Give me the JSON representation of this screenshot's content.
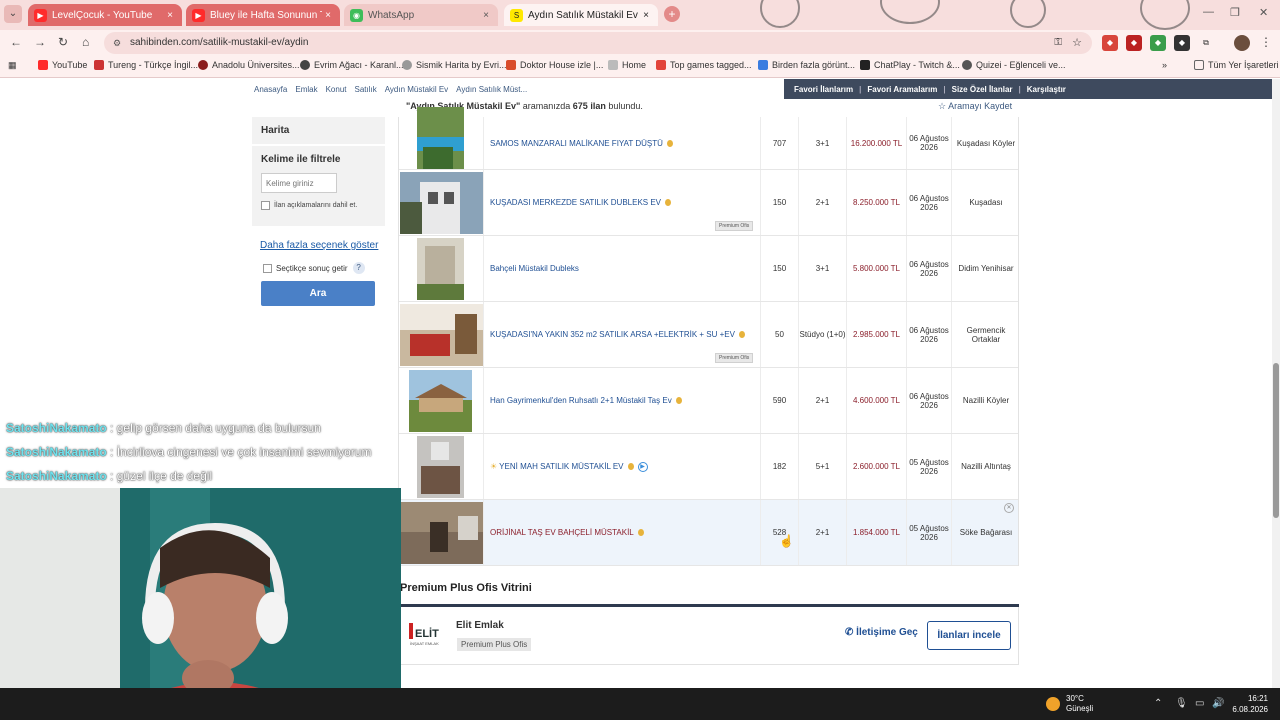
{
  "tabs": [
    {
      "title": "LevelÇocuk - YouTube",
      "close": "×"
    },
    {
      "title": "Bluey ile Hafta Sonunun Tadını",
      "close": "×"
    },
    {
      "title": "WhatsApp",
      "close": "×"
    },
    {
      "title": "Aydın Satılık Müstakil Ev Fiyatl",
      "close": "×"
    }
  ],
  "new_tab": "+",
  "url": "sahibinden.com/satilik-mustakil-ev/aydin",
  "bookmarks": [
    "YouTube",
    "Tureng - Türkçe İngil...",
    "Anadolu Üniversites...",
    "Evrim Ağacı - Karanl...",
    "Sismik Harita by Evri...",
    "Doktor House izle |...",
    "Home",
    "Top games tagged...",
    "Birden fazla görünt...",
    "ChatPlay - Twitch &...",
    "Quizei - Eğlenceli ve..."
  ],
  "bookmarks_more": "»",
  "all_bookmarks": "Tüm Yer İşaretleri",
  "breadcrumb": [
    "Anasayfa",
    "Emlak",
    "Konut",
    "Satılık",
    "Aydın Müstakil Ev",
    "Aydın Satılık Müst..."
  ],
  "topnav": [
    "Favori İlanlarım",
    "Favori Aramalarım",
    "Size Özel İlanlar",
    "Karşılaştır"
  ],
  "result": {
    "query": "\"Aydın Satılık Müstakil Ev\"",
    "mid": "aramanızda",
    "count": "675 ilan",
    "end": "bulundu."
  },
  "save_search": "Aramayı Kaydet",
  "sidebar": {
    "map": "Harita",
    "kw_title": "Kelime ile filtrele",
    "kw_placeholder": "Kelime giriniz",
    "kw_check": "İlan açıklamalarını dahil et.",
    "more": "Daha fazla seçenek göster",
    "select_results": "Seçtikçe sonuç getir",
    "help": "?",
    "search_btn": "Ara"
  },
  "listings": [
    {
      "title": "SAMOS MANZARALI MALİKANE FIYAT DÜŞTÜ",
      "m2": "707",
      "rooms": "3+1",
      "price": "16.200.000 TL",
      "date": "06 Ağustos 2026",
      "loc": "Kuşadası Köyler"
    },
    {
      "title": "KUŞADASI MERKEZDE SATILIK DUBLEKS EV",
      "m2": "150",
      "rooms": "2+1",
      "price": "8.250.000 TL",
      "date": "06 Ağustos 2026",
      "loc": "Kuşadası",
      "badge": "Premium Ofis"
    },
    {
      "title": "Bahçeli Müstakil Dubleks",
      "m2": "150",
      "rooms": "3+1",
      "price": "5.800.000 TL",
      "date": "06 Ağustos 2026",
      "loc": "Didim Yenihisar"
    },
    {
      "title": "KUŞADASI'NA YAKIN 352 m2 SATILIK ARSA +ELEKTRİK + SU +EV",
      "m2": "50",
      "rooms": "Stüdyo (1+0)",
      "price": "2.985.000 TL",
      "date": "06 Ağustos 2026",
      "loc": "Germencik Ortaklar",
      "badge": "Premium Ofis"
    },
    {
      "title": "Han Gayrimenkul'den Ruhsatlı 2+1 Müstakil Taş Ev",
      "m2": "590",
      "rooms": "2+1",
      "price": "4.600.000 TL",
      "date": "06 Ağustos 2026",
      "loc": "Nazilli Köyler"
    },
    {
      "title": "YENİ MAH SATILIK MÜSTAKİL EV",
      "m2": "182",
      "rooms": "5+1",
      "price": "2.600.000 TL",
      "date": "05 Ağustos 2026",
      "loc": "Nazilli Altıntaş"
    },
    {
      "title": "ORİJİNAL TAŞ EV BAHÇELİ MÜSTAKİL",
      "m2": "528",
      "rooms": "2+1",
      "price": "1.854.000 TL",
      "date": "05 Ağustos 2026",
      "loc": "Söke Bağarası"
    }
  ],
  "premium": {
    "title": "Premium Plus Ofis Vitrini",
    "agent": "Elit Emlak",
    "badge": "Premium Plus Ofis",
    "contact": "İletişime Geç",
    "listings_btn": "İlanları incele",
    "logo_text": "ELİT",
    "logo_sub": "İNŞAAT EMLAK"
  },
  "chat": [
    {
      "user": "SatoshiNakamato",
      "msg": ": gelip görsen daha uyguna da bulursun"
    },
    {
      "user": "SatoshiNakamato",
      "msg": ": İncirliova cingenesi ve çok insanimi sevmiyorum"
    },
    {
      "user": "SatoshiNakamato",
      "msg": ": güzel ilçe de değil"
    }
  ],
  "taskbar": {
    "temp": "30°C",
    "weather": "Güneşli",
    "time": "16:21",
    "date": "6.08.2026"
  },
  "colors": {
    "accent": "#4a80c7",
    "price": "#8b1f2b",
    "tab_bg": "#f7dedd"
  }
}
